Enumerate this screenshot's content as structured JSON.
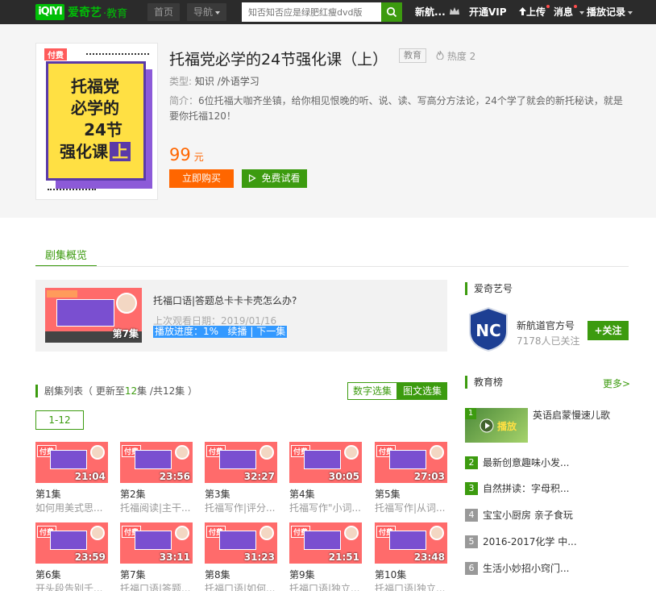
{
  "nav": {
    "logo_mark": "iQIYI",
    "logo_text": "爱奇艺",
    "logo_sub": "·教育",
    "home": "首页",
    "guide": "导航",
    "search_placeholder": "知否知否应是绿肥红瘦dvd版",
    "user": "新航...",
    "vip": "开通VIP",
    "upload": "上传",
    "messages": "消息",
    "history": "播放记录"
  },
  "course": {
    "cover_tag": "付费",
    "cover_title_l1": "托福党",
    "cover_title_l2": "必学的",
    "cover_title_l3": "24节",
    "cover_title_l4": "强化课",
    "cover_title_l5": "上",
    "title": "托福党必学的24节强化课（上）",
    "category_badge": "教育",
    "hot_label": "热度 2",
    "type_label": "类型:",
    "type_value": "知识 /外语学习",
    "intro_label": "简介：",
    "intro_text": "6位托福大咖齐坐镇，给你相见恨晚的听、说、读、写高分方法论，24个学了就会的新托秘诀，就是要你托福120！",
    "price": "99",
    "price_unit": "元",
    "buy_label": "立即购买",
    "trial_label": "免费试看"
  },
  "overview": {
    "tab_label": "剧集概览"
  },
  "last_watched": {
    "ep_label": "第7集",
    "title": "托福口语|答题总卡卡卡壳怎么办?",
    "date": "上次观看日期：2019/01/16",
    "progress": "播放进度：1%",
    "continue": "续播",
    "sep": "|",
    "next": "下一集"
  },
  "episodes": {
    "head_prefix": "剧集列表（ 更新至",
    "head_count": "12",
    "head_mid": "集 /共",
    "head_total": "12集 ）",
    "mode_num": "数字选集",
    "mode_pic": "图文选集",
    "range": "1-12",
    "items": [
      {
        "num": "第1集",
        "sub": "如何用美式思...",
        "dur": "21:04",
        "pay": "付费"
      },
      {
        "num": "第2集",
        "sub": "托福阅读|主干...",
        "dur": "23:56",
        "pay": "付费"
      },
      {
        "num": "第3集",
        "sub": "托福写作|评分...",
        "dur": "32:27",
        "pay": "付费"
      },
      {
        "num": "第4集",
        "sub": "托福写作\"小词...",
        "dur": "30:05",
        "pay": "付费"
      },
      {
        "num": "第5集",
        "sub": "托福写作|从词...",
        "dur": "27:03",
        "pay": "付费"
      },
      {
        "num": "第6集",
        "sub": "开头段告别千...",
        "dur": "23:59",
        "pay": "付费"
      },
      {
        "num": "第7集",
        "sub": "托福口语|答题...",
        "dur": "33:11",
        "pay": "付费"
      },
      {
        "num": "第8集",
        "sub": "托福口语|如何...",
        "dur": "31:23",
        "pay": "付费"
      },
      {
        "num": "第9集",
        "sub": "托福口语|独立...",
        "dur": "21:51",
        "pay": "付费"
      },
      {
        "num": "第10集",
        "sub": "托福口语|独立...",
        "dur": "23:48",
        "pay": "付费"
      }
    ]
  },
  "sidebar": {
    "account_head": "爱奇艺号",
    "account_name": "新航道官方号",
    "account_fans": "7178人已关注",
    "follow_label": "+关注",
    "rank_head": "教育榜",
    "more_label": "更多>",
    "rank": [
      {
        "num": "1",
        "title": "英语启蒙慢速儿歌",
        "color": "#3c9b0f"
      },
      {
        "num": "2",
        "title": "最新创意趣味小发...",
        "color": "#3c9b0f"
      },
      {
        "num": "3",
        "title": "自然拼读：字母积...",
        "color": "#3c9b0f"
      },
      {
        "num": "4",
        "title": "宝宝小厨房 亲子食玩",
        "color": "#999999"
      },
      {
        "num": "5",
        "title": "2016-2017化学 中...",
        "color": "#999999"
      },
      {
        "num": "6",
        "title": "生活小妙招小窍门...",
        "color": "#999999"
      }
    ],
    "rank1_overlay": "播放"
  },
  "colors": {
    "brand_green": "#3c9b0f",
    "price_orange": "#ff6600",
    "nav_bg": "#2b2b2b"
  }
}
